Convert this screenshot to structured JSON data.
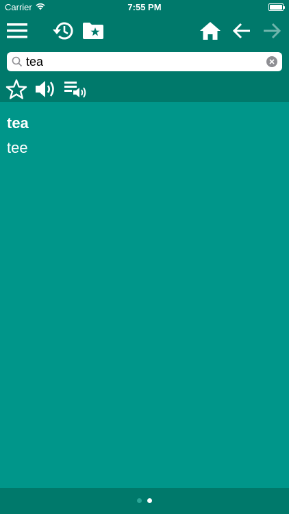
{
  "status_bar": {
    "carrier": "Carrier",
    "time": "7:55 PM"
  },
  "toolbar": {
    "icons": {
      "menu": "menu-icon",
      "history": "history-icon",
      "favorites_folder": "folder-star-icon",
      "home": "home-icon",
      "back": "arrow-left-icon",
      "forward": "arrow-right-icon"
    },
    "forward_enabled": false
  },
  "search": {
    "value": "tea"
  },
  "actions": {
    "icons": {
      "favorite": "star-outline-icon",
      "speak": "speaker-icon",
      "speak_list": "playlist-speaker-icon"
    }
  },
  "entry": {
    "word": "tea",
    "translation": "tee"
  },
  "pager": {
    "pages": 2,
    "current": 2
  },
  "colors": {
    "bar": "#00796b",
    "background": "#00968a",
    "icon": "#ffffff",
    "icon_disabled": "#6fb5ac"
  }
}
